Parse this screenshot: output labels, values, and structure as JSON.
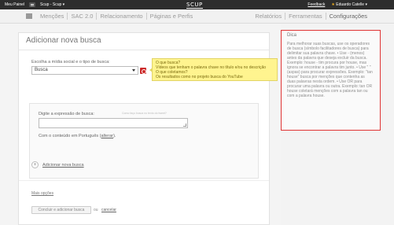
{
  "topbar": {
    "panel_label": "Meu Painel",
    "account": "Scup - Scup ▾",
    "logo": "SCUP",
    "feedback": "Feedback",
    "user": "Eduardo Catelle ▾"
  },
  "nav": {
    "left": [
      "Menções",
      "SAC 2.0",
      "Relacionamento",
      "Páginas e Perfis"
    ],
    "right": [
      "Relatórios",
      "Ferramentas",
      "Configurações"
    ],
    "active": "Configurações"
  },
  "main": {
    "title": "Adicionar nova busca",
    "select_label": "Escolha a mídia social e o tipo de busca:",
    "select_value": "Busca",
    "tooltip_lines": [
      "O que busca?",
      "Vídeos que tenham o palavra chave no título e/ou no descrição",
      "O que coletamos?",
      "Os resultados como no projeto busca do YouTube"
    ],
    "expr_label": "Digite a expressão de busca:",
    "expr_hint": "Como faço busca no texto do tweet?",
    "expr_value": "",
    "lang_prefix": "Com o conteúdo em Português (",
    "lang_link": "alterar",
    "lang_suffix": ").",
    "add_label": "Adicionar nova busca",
    "more_options": "Mais opções",
    "conclude_button": "Concluir e adicionar busca",
    "or_text": "ou",
    "cancel_link": "cancelar"
  },
  "tips": {
    "title": "Dica",
    "body": "Para melhorar suas buscas, use os operadores de busca (símbolo facilitadores de busca) para delimitar sua palavra chave. • Use - (menos) antes da palavra que deseja excluir da busca. Exemplo: house - tim procura por house, mas ignora se encontrar a palavra tim junto. • Use \" \" (aspas) para procurar expressões. Exemplo: \"tan house\" busca por menções que contenha as duas palavras nesta ordem. • Use OR para procurar uma palavra ou outra. Exemplo: tan OR house coletará menções com a palavra tan ou com a palavra house."
  }
}
